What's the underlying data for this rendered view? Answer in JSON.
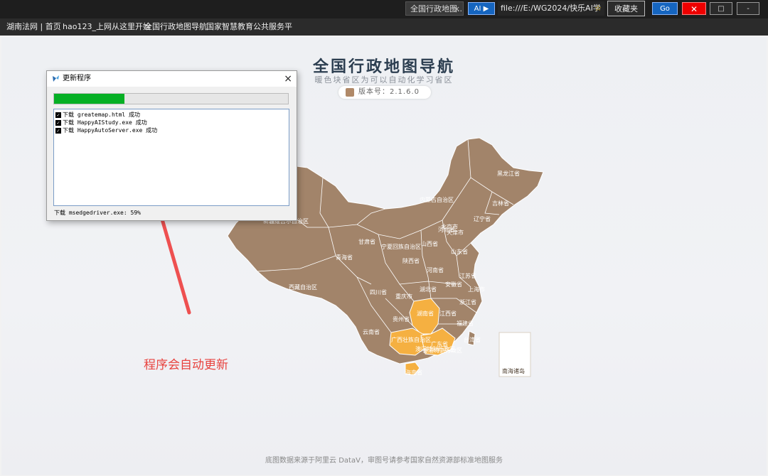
{
  "topbar": {
    "tab_title": "全国行政地图...",
    "tab_close": "×",
    "ai_button": "AI ▶",
    "url": "file:///E:/WG2024/快乐AI学",
    "favorites": "收藏夹",
    "go": "Go",
    "close": "✕",
    "maximize": "□",
    "minimize": "-"
  },
  "bookmarks": [
    "湖南法网 | 首页",
    "hao123_上网从这里开始",
    "全国行政地图导航",
    "国家智慧教育公共服务平"
  ],
  "page": {
    "title": "全国行政地图导航",
    "subtitle": "暖色块省区为可以自动化学习省区",
    "version": "版本号：2.1.6.0",
    "footer": "底图数据来源于阿里云 DataV，审图号请参考国家自然资源部标准地图服务",
    "annotation": "程序会自动更新",
    "colors": {
      "province": "#a2846a",
      "highlight": "#f5b041",
      "border": "#ffffff",
      "arrow": "#ee5050"
    }
  },
  "map": {
    "provinces": [
      "黑龙江省",
      "吉林省",
      "辽宁省",
      "内蒙古自治区",
      "新疆维吾尔自治区",
      "甘肃省",
      "宁夏回族自治区",
      "北京市",
      "天津市",
      "山西省",
      "河北省",
      "山东省",
      "陕西省",
      "青海省",
      "河南省",
      "江苏省",
      "安徽省",
      "上海市",
      "四川省",
      "湖北省",
      "重庆市",
      "浙江省",
      "西藏自治区",
      "湖南省",
      "江西省",
      "贵州省",
      "福建省",
      "云南省",
      "广西壮族自治区",
      "广东省",
      "台湾省",
      "香港特别行政区",
      "澳门特别行政区",
      "海南省",
      "南海诸岛"
    ],
    "highlighted": [
      "湖南省",
      "广西壮族自治区",
      "广东省"
    ]
  },
  "dialog": {
    "title": "更新程序",
    "close": "×",
    "progress_percent": 30,
    "log": [
      "下载 greatemap.html 成功",
      "下载 HappyAIStudy.exe 成功",
      "下载 HappyAutoServer.exe 成功"
    ],
    "status": "下载 msedgedriver.exe: 59%"
  }
}
